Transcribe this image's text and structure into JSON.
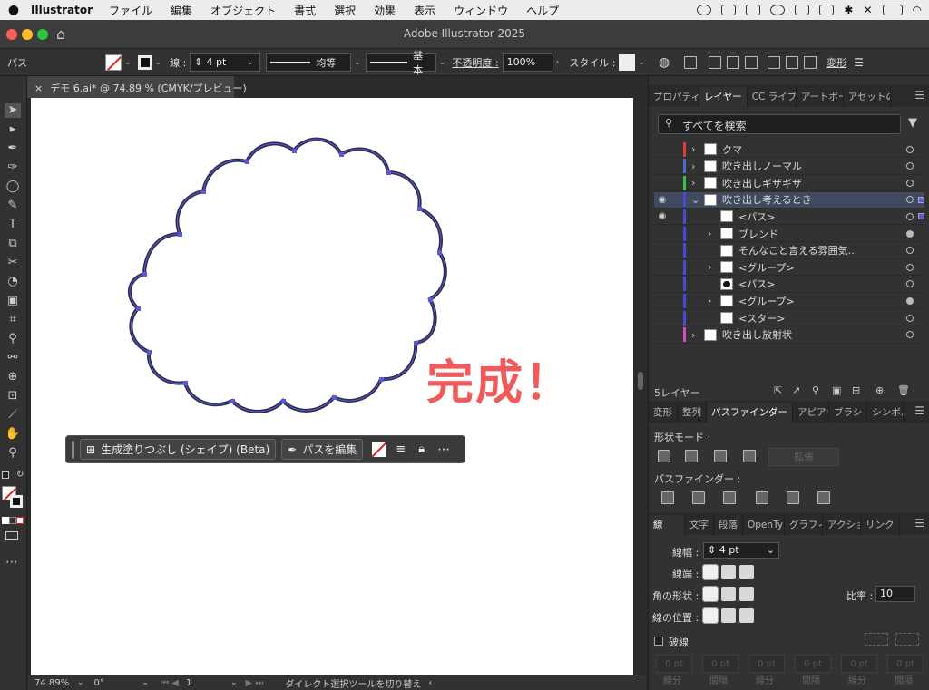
{
  "menubar": {
    "app": "Illustrator",
    "items": [
      "ファイル",
      "編集",
      "オブジェクト",
      "書式",
      "選択",
      "効果",
      "表示",
      "ウィンドウ",
      "ヘルプ"
    ]
  },
  "titlebar": {
    "title": "Adobe Illustrator 2025"
  },
  "control": {
    "object_type": "パス",
    "stroke_label": "線 :",
    "stroke_value": "4 pt",
    "profile": "均等",
    "brush": "基本",
    "opacity_label": "不透明度 :",
    "opacity_value": "100%",
    "style_label": "スタイル :",
    "transform": "変形"
  },
  "document": {
    "tab": "デモ 6.ai* @ 74.89 % (CMYK/プレビュー)",
    "artwork_text": "完成！"
  },
  "ctxbar": {
    "fill_button": "生成塗りつぶし (シェイプ) (Beta)",
    "edit_path": "パスを編集"
  },
  "status": {
    "zoom": "74.89%",
    "rotation": "0°",
    "artboard": "1",
    "tool_message": "ダイレクト選択ツールを切り替え"
  },
  "layers_panel": {
    "tabs": [
      "プロパティ",
      "レイヤー",
      "CC ライブ",
      "アートボー",
      "アセットの"
    ],
    "search_placeholder": "すべてを検索",
    "layers": [
      {
        "name": "クマ",
        "color": "#e03a3a",
        "expanded": false
      },
      {
        "name": "吹き出しノーマル",
        "color": "#4a6cd8",
        "expanded": false
      },
      {
        "name": "吹き出しギザギザ",
        "color": "#3cc04a",
        "expanded": false
      },
      {
        "name": "吹き出し考えるとき",
        "color": "#4a4ad8",
        "expanded": true,
        "selected": true
      },
      {
        "name": "<パス>",
        "child": true
      },
      {
        "name": "ブレンド",
        "child": true
      },
      {
        "name": "そんなこと言える雰囲気...",
        "child": true
      },
      {
        "name": "<グループ>",
        "child": true
      },
      {
        "name": "<パス>",
        "child": true
      },
      {
        "name": "<グループ>",
        "child": true
      },
      {
        "name": "<スター>",
        "child": true
      },
      {
        "name": "吹き出し放射状",
        "color": "#d84ac8",
        "expanded": false
      }
    ],
    "layer_count": "5レイヤー"
  },
  "pathfinder_panel": {
    "tabs": [
      "変形",
      "整列",
      "パスファインダー",
      "アピアラ",
      "ブラシ",
      "シンボル"
    ],
    "shape_modes": "形状モード :",
    "expand": "拡張",
    "pathfinders": "パスファインダー :"
  },
  "stroke_panel": {
    "tabs": [
      "線",
      "文字",
      "段落",
      "OpenTy",
      "グラフィ",
      "アクショ",
      "リンク"
    ],
    "weight_label": "線幅 :",
    "weight_value": "4 pt",
    "cap_label": "線端 :",
    "corner_label": "角の形状 :",
    "limit_label": "比率 :",
    "limit_value": "10",
    "align_label": "線の位置 :",
    "dashed_label": "破線",
    "dash_labels": [
      "線分",
      "間隔",
      "線分",
      "間隔",
      "線分",
      "間隔"
    ]
  },
  "colors": {
    "accent": "#f15a5a",
    "path": "#2a2a4a",
    "anchor": "#5a5ad8"
  }
}
